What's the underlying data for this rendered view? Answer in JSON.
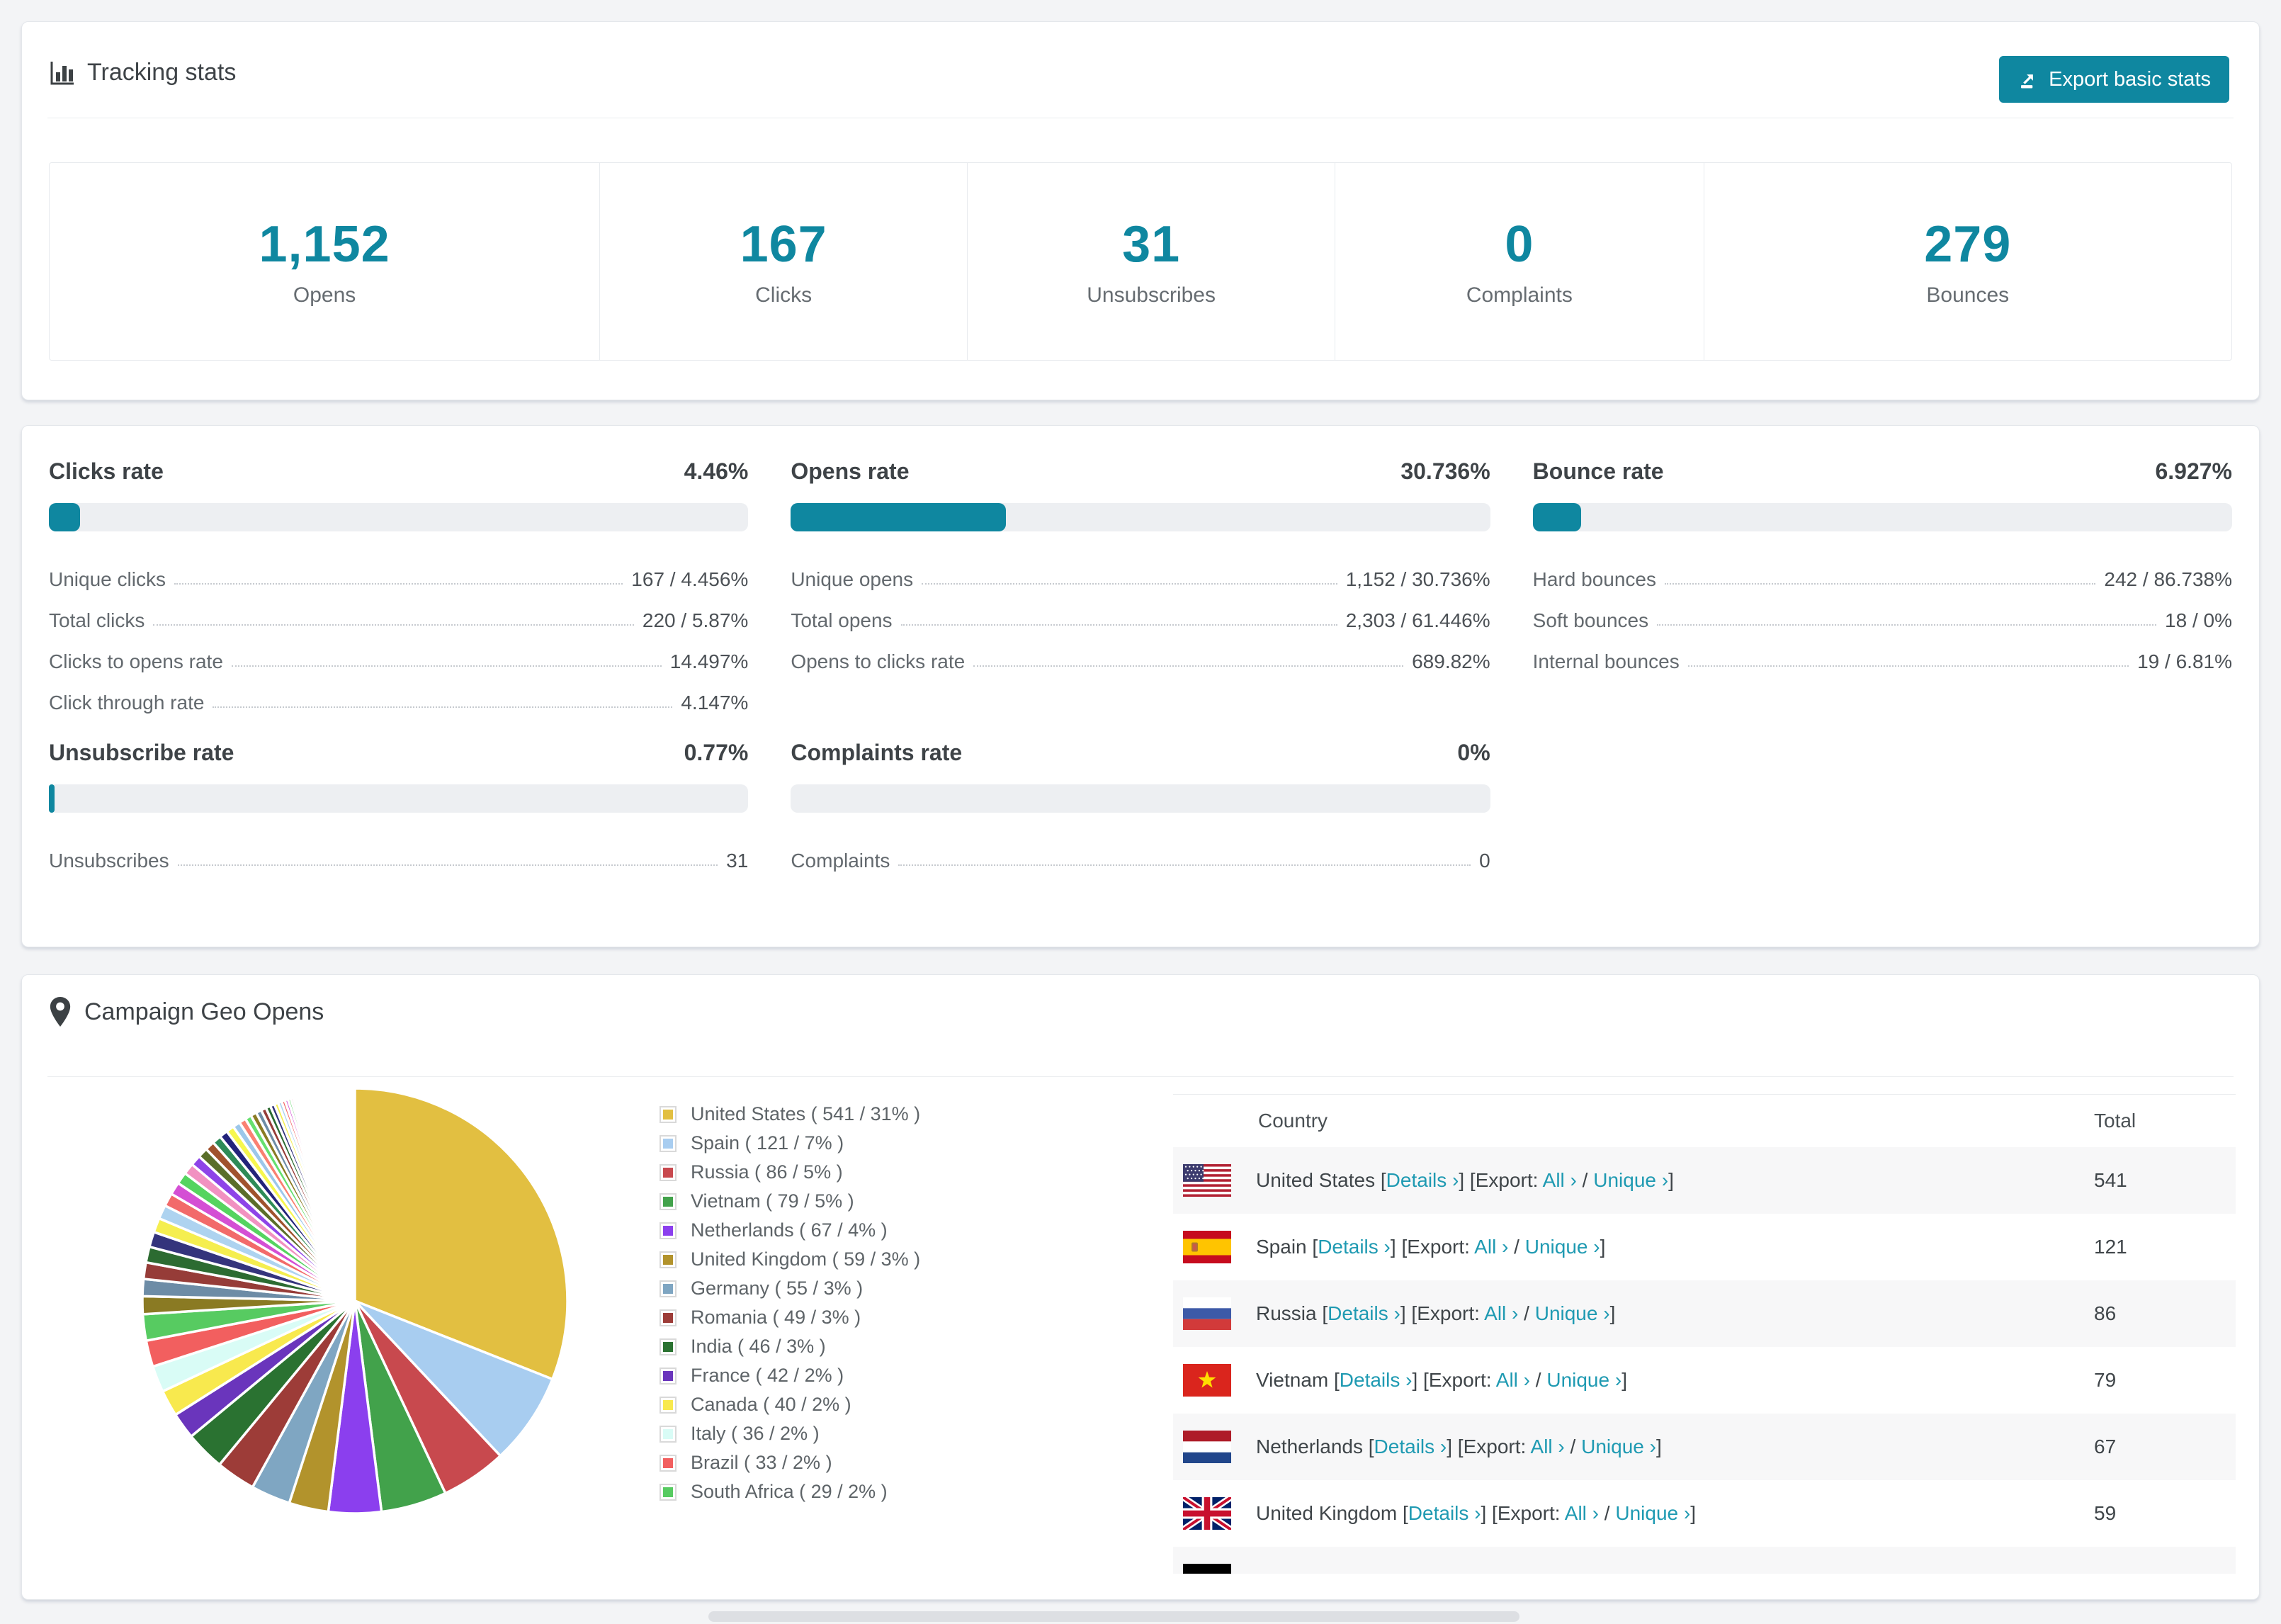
{
  "app": {
    "accent": "#0f87a0",
    "link_color": "#1f9ab2",
    "page_bg": "#f3f4f6"
  },
  "tracking": {
    "title": "Tracking stats",
    "icon": "bar-chart-icon",
    "export_button": {
      "label": "Export basic stats",
      "icon": "export-icon"
    },
    "stats": [
      {
        "value": "1,152",
        "label": "Opens"
      },
      {
        "value": "167",
        "label": "Clicks"
      },
      {
        "value": "31",
        "label": "Unsubscribes"
      },
      {
        "value": "0",
        "label": "Complaints"
      },
      {
        "value": "279",
        "label": "Bounces"
      }
    ]
  },
  "rates": [
    {
      "title": "Clicks rate",
      "value": "4.46%",
      "percent": 4.46,
      "rows": [
        {
          "label": "Unique clicks",
          "value": "167 / 4.456%"
        },
        {
          "label": "Total clicks",
          "value": "220 / 5.87%"
        },
        {
          "label": "Clicks to opens rate",
          "value": "14.497%"
        },
        {
          "label": "Click through rate",
          "value": "4.147%"
        }
      ]
    },
    {
      "title": "Opens rate",
      "value": "30.736%",
      "percent": 30.736,
      "rows": [
        {
          "label": "Unique opens",
          "value": "1,152 / 30.736%"
        },
        {
          "label": "Total opens",
          "value": "2,303 / 61.446%"
        },
        {
          "label": "Opens to clicks rate",
          "value": "689.82%"
        }
      ]
    },
    {
      "title": "Bounce rate",
      "value": "6.927%",
      "percent": 6.927,
      "rows": [
        {
          "label": "Hard bounces",
          "value": "242 / 86.738%"
        },
        {
          "label": "Soft bounces",
          "value": "18 / 0%"
        },
        {
          "label": "Internal bounces",
          "value": "19 / 6.81%"
        }
      ]
    },
    {
      "title": "Unsubscribe rate",
      "value": "0.77%",
      "percent": 0.77,
      "rows": [
        {
          "label": "Unsubscribes",
          "value": "31"
        }
      ]
    },
    {
      "title": "Complaints rate",
      "value": "0%",
      "percent": 0,
      "rows": [
        {
          "label": "Complaints",
          "value": "0"
        }
      ]
    }
  ],
  "geo": {
    "title": "Campaign Geo Opens",
    "icon": "map-pin-icon",
    "table": {
      "headers": {
        "country": "Country",
        "total": "Total"
      },
      "link_labels": {
        "details": "Details ›",
        "export_prefix": "Export:",
        "all": "All ›",
        "unique": "Unique ›"
      },
      "rows": [
        {
          "flag": "us",
          "country": "United States",
          "total": "541"
        },
        {
          "flag": "es",
          "country": "Spain",
          "total": "121"
        },
        {
          "flag": "ru",
          "country": "Russia",
          "total": "86"
        },
        {
          "flag": "vn",
          "country": "Vietnam",
          "total": "79"
        },
        {
          "flag": "nl",
          "country": "Netherlands",
          "total": "67"
        },
        {
          "flag": "gb",
          "country": "United Kingdom",
          "total": "59"
        }
      ],
      "partial_row": {
        "flag": "de"
      }
    }
  },
  "chart_data": {
    "type": "pie",
    "title": "Campaign Geo Opens",
    "legend_position": "right",
    "start_angle_deg": 0,
    "series": [
      {
        "name": "United States",
        "opens": 541,
        "percent": 31,
        "color": "#e2bf41",
        "legend": "United States ( 541 / 31% )"
      },
      {
        "name": "Spain",
        "opens": 121,
        "percent": 7,
        "color": "#a8cdf0",
        "legend": "Spain ( 121 / 7% )"
      },
      {
        "name": "Russia",
        "opens": 86,
        "percent": 5,
        "color": "#c8494e",
        "legend": "Russia ( 86 / 5% )"
      },
      {
        "name": "Vietnam",
        "opens": 79,
        "percent": 5,
        "color": "#42a24b",
        "legend": "Vietnam ( 79 / 5% )"
      },
      {
        "name": "Netherlands",
        "opens": 67,
        "percent": 4,
        "color": "#8b3fee",
        "legend": "Netherlands ( 67 / 4% )"
      },
      {
        "name": "United Kingdom",
        "opens": 59,
        "percent": 3,
        "color": "#b2932c",
        "legend": "United Kingdom ( 59 / 3% )"
      },
      {
        "name": "Germany",
        "opens": 55,
        "percent": 3,
        "color": "#7fa6c2",
        "legend": "Germany ( 55 / 3% )"
      },
      {
        "name": "Romania",
        "opens": 49,
        "percent": 3,
        "color": "#9d3c38",
        "legend": "Romania ( 49 / 3% )"
      },
      {
        "name": "India",
        "opens": 46,
        "percent": 3,
        "color": "#2a7231",
        "legend": "India ( 46 / 3% )"
      },
      {
        "name": "France",
        "opens": 42,
        "percent": 2,
        "color": "#6a35bc",
        "legend": "France ( 42 / 2% )"
      },
      {
        "name": "Canada",
        "opens": 40,
        "percent": 2,
        "color": "#f8e94e",
        "legend": "Canada ( 40 / 2% )"
      },
      {
        "name": "Italy",
        "opens": 36,
        "percent": 2,
        "color": "#d9fcf6",
        "legend": "Italy ( 36 / 2% )"
      },
      {
        "name": "Brazil",
        "opens": 33,
        "percent": 2,
        "color": "#f25f5f",
        "legend": "Brazil ( 33 / 2% )"
      },
      {
        "name": "South Africa",
        "opens": 29,
        "percent": 2,
        "color": "#57cb61",
        "legend": "South Africa ( 29 / 2% )"
      }
    ],
    "other_slices": {
      "note": "unlabeled small-country slices fanning to hairlines near 12 o'clock",
      "values": [
        1.35,
        1.3,
        1.25,
        1.2,
        1.15,
        1.1,
        1.05,
        1.0,
        0.95,
        0.9,
        0.85,
        0.8,
        0.76,
        0.72,
        0.68,
        0.64,
        0.6,
        0.56,
        0.52,
        0.48,
        0.45,
        0.42,
        0.39,
        0.36,
        0.33,
        0.3,
        0.28,
        0.26,
        0.24,
        0.22,
        0.2,
        0.18,
        0.16,
        0.14,
        0.12,
        0.11,
        0.1,
        0.09,
        0.08,
        0.07,
        0.06,
        0.05,
        0.05,
        0.04,
        0.04,
        0.03
      ],
      "colors": [
        "#8a7a23",
        "#6d8ca6",
        "#963c38",
        "#2c6b31",
        "#34347c",
        "#f5ee4f",
        "#aed3f0",
        "#f26a6a",
        "#d44fd4",
        "#55d45f",
        "#f191c1",
        "#8e44e8",
        "#5a6e2a",
        "#a0522d",
        "#2e8b57",
        "#23237a",
        "#f7f74e",
        "#9cc7ea",
        "#fa8072",
        "#66e06f"
      ]
    }
  }
}
